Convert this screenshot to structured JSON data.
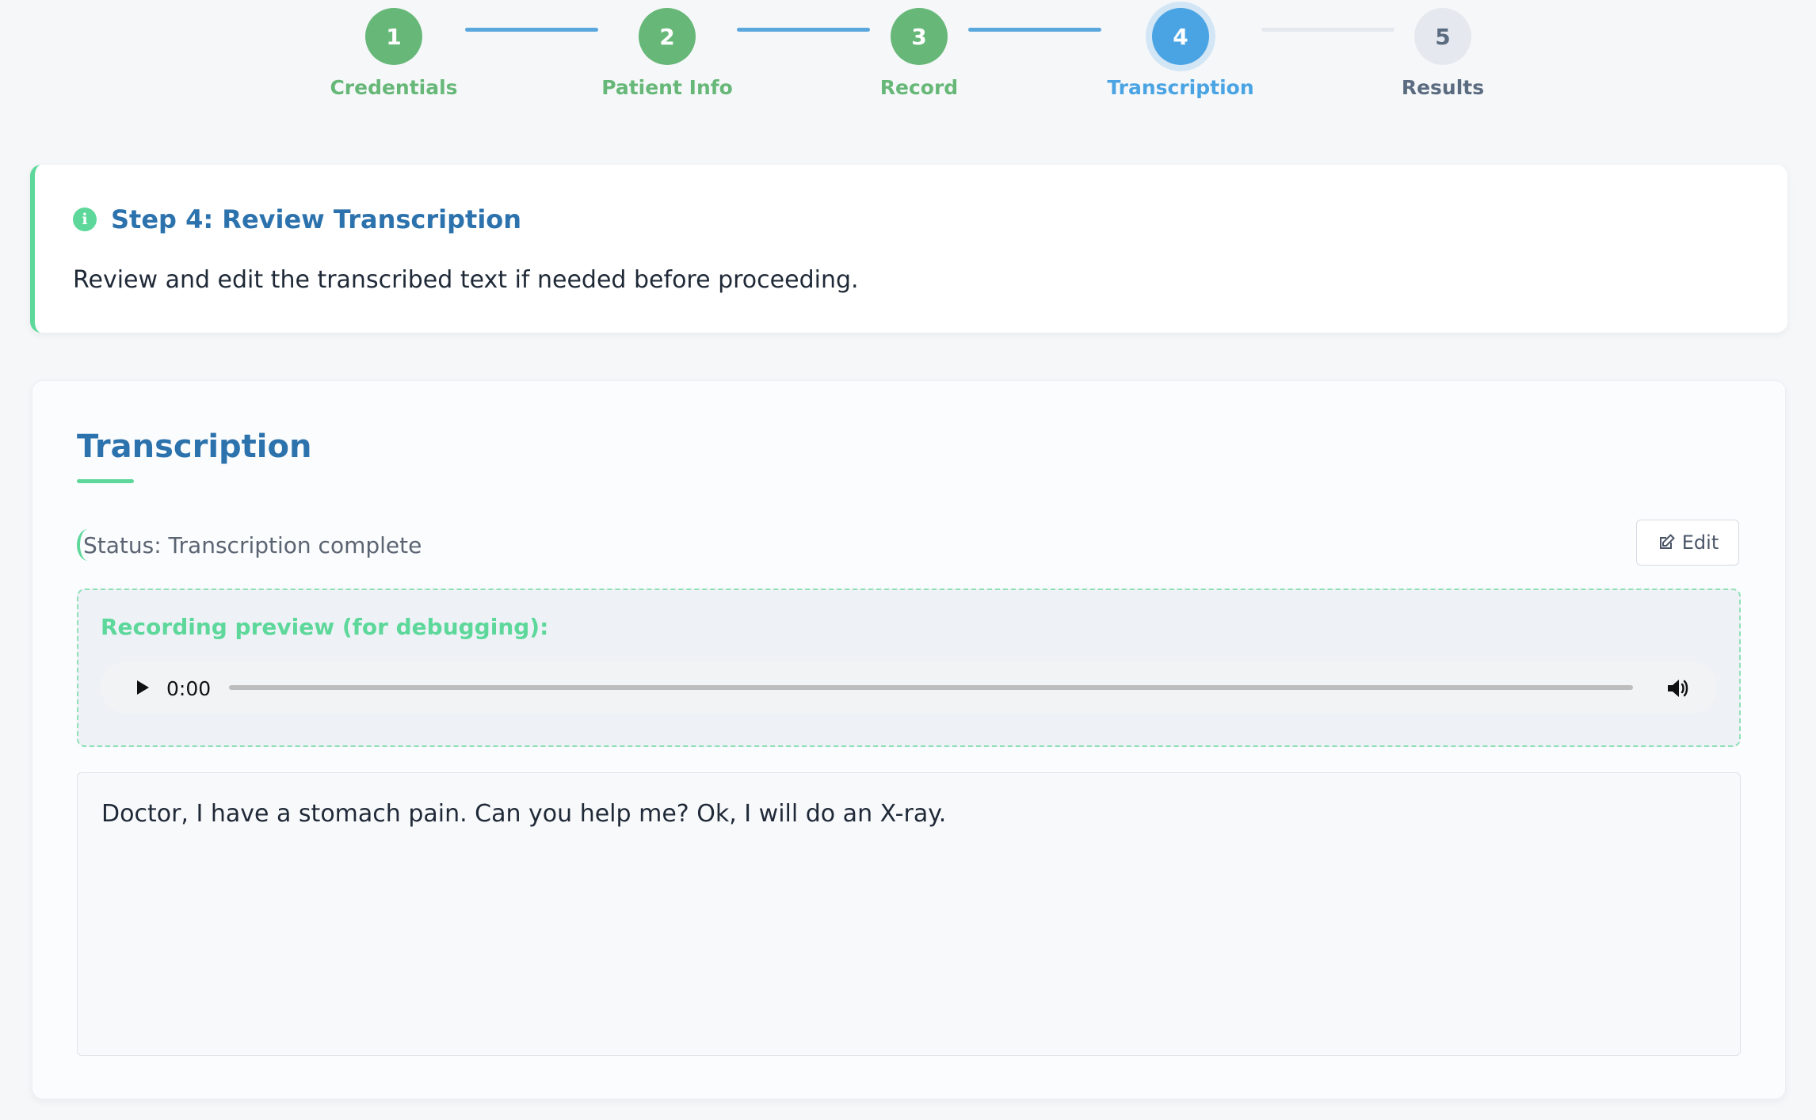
{
  "stepper": {
    "steps": [
      {
        "number": "1",
        "label": "Credentials",
        "state": "done"
      },
      {
        "number": "2",
        "label": "Patient Info",
        "state": "done"
      },
      {
        "number": "3",
        "label": "Record",
        "state": "done"
      },
      {
        "number": "4",
        "label": "Transcription",
        "state": "active"
      },
      {
        "number": "5",
        "label": "Results",
        "state": "todo"
      }
    ]
  },
  "info": {
    "icon": "info-icon",
    "icon_glyph": "i",
    "title": "Step 4: Review Transcription",
    "text": "Review and edit the transcribed text if needed before proceeding."
  },
  "transcription": {
    "title": "Transcription",
    "status": "Status: Transcription complete",
    "edit_label": "Edit",
    "preview_label": "Recording preview (for debugging):",
    "audio": {
      "time": "0:00",
      "progress": 0
    },
    "text": "Doctor, I have a stomach pain. Can you help me? Ok, I will do an X-ray."
  },
  "colors": {
    "primary_blue": "#2c72ad",
    "active_blue": "#4aa4e3",
    "done_green": "#67b878",
    "accent_green": "#5dd89a",
    "todo_gray": "#e5e9ef"
  }
}
